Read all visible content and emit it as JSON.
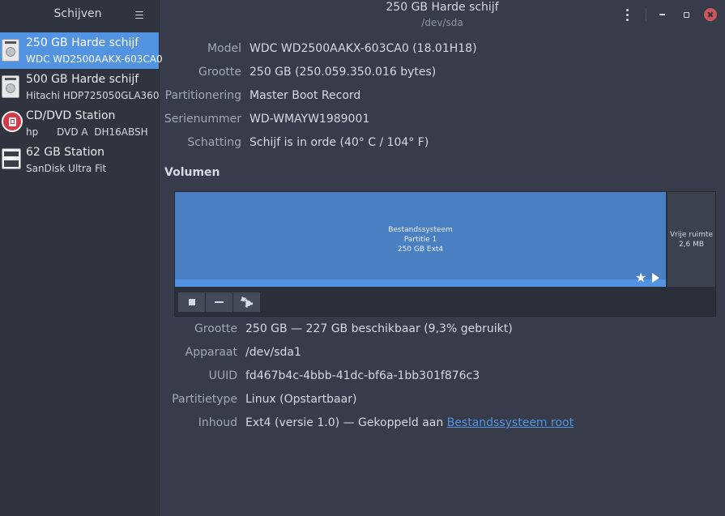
{
  "sidebar": {
    "title": "Schijven",
    "drives": [
      {
        "title": "250 GB Harde schijf",
        "subtitle": "WDC WD2500AAKX-603CA0",
        "icon": "hard-disk-icon",
        "selected": true
      },
      {
        "title": "500 GB Harde schijf",
        "subtitle": "Hitachi HDP725050GLA360",
        "icon": "hard-disk-icon",
        "selected": false
      },
      {
        "title": "CD/DVD Station",
        "subtitle": "hp      DVD A  DH16ABSH",
        "icon": "optical-drive-icon",
        "selected": false
      },
      {
        "title": "62 GB Station",
        "subtitle": "SanDisk Ultra Fit",
        "icon": "usb-drive-icon",
        "selected": false
      }
    ]
  },
  "header": {
    "title": "250 GB Harde schijf",
    "subtitle": "/dev/sda"
  },
  "disk_info": [
    {
      "label": "Model",
      "value": "WDC WD2500AAKX-603CA0 (18.01H18)"
    },
    {
      "label": "Grootte",
      "value": "250 GB (250.059.350.016 bytes)"
    },
    {
      "label": "Partitionering",
      "value": "Master Boot Record"
    },
    {
      "label": "Serienummer",
      "value": "WD-WMAYW1989001"
    },
    {
      "label": "Schatting",
      "value": "Schijf is in orde (40° C / 104° F)"
    }
  ],
  "volumes": {
    "heading": "Volumen",
    "partition": {
      "line1": "Bestandssysteem",
      "line2": "Partitie 1",
      "line3": "250 GB Ext4"
    },
    "free": {
      "line1": "Vrije ruimte",
      "line2": "2,6 MB"
    }
  },
  "partition_info": [
    {
      "label": "Grootte",
      "value": "250 GB — 227 GB beschikbaar (9,3% gebruikt)"
    },
    {
      "label": "Apparaat",
      "value": "/dev/sda1"
    },
    {
      "label": "UUID",
      "value": "fd467b4c-4bbb-41dc-bf6a-1bb301f876c3"
    },
    {
      "label": "Partitietype",
      "value": "Linux (Opstartbaar)"
    },
    {
      "label": "Inhoud",
      "value_prefix": "Ext4 (versie 1.0) — Gekoppeld aan ",
      "link": "Bestandssysteem root"
    }
  ],
  "colors": {
    "accent": "#5294e2",
    "background": "#383c4a",
    "sidebar": "#2f343f",
    "close": "#cc575d"
  }
}
